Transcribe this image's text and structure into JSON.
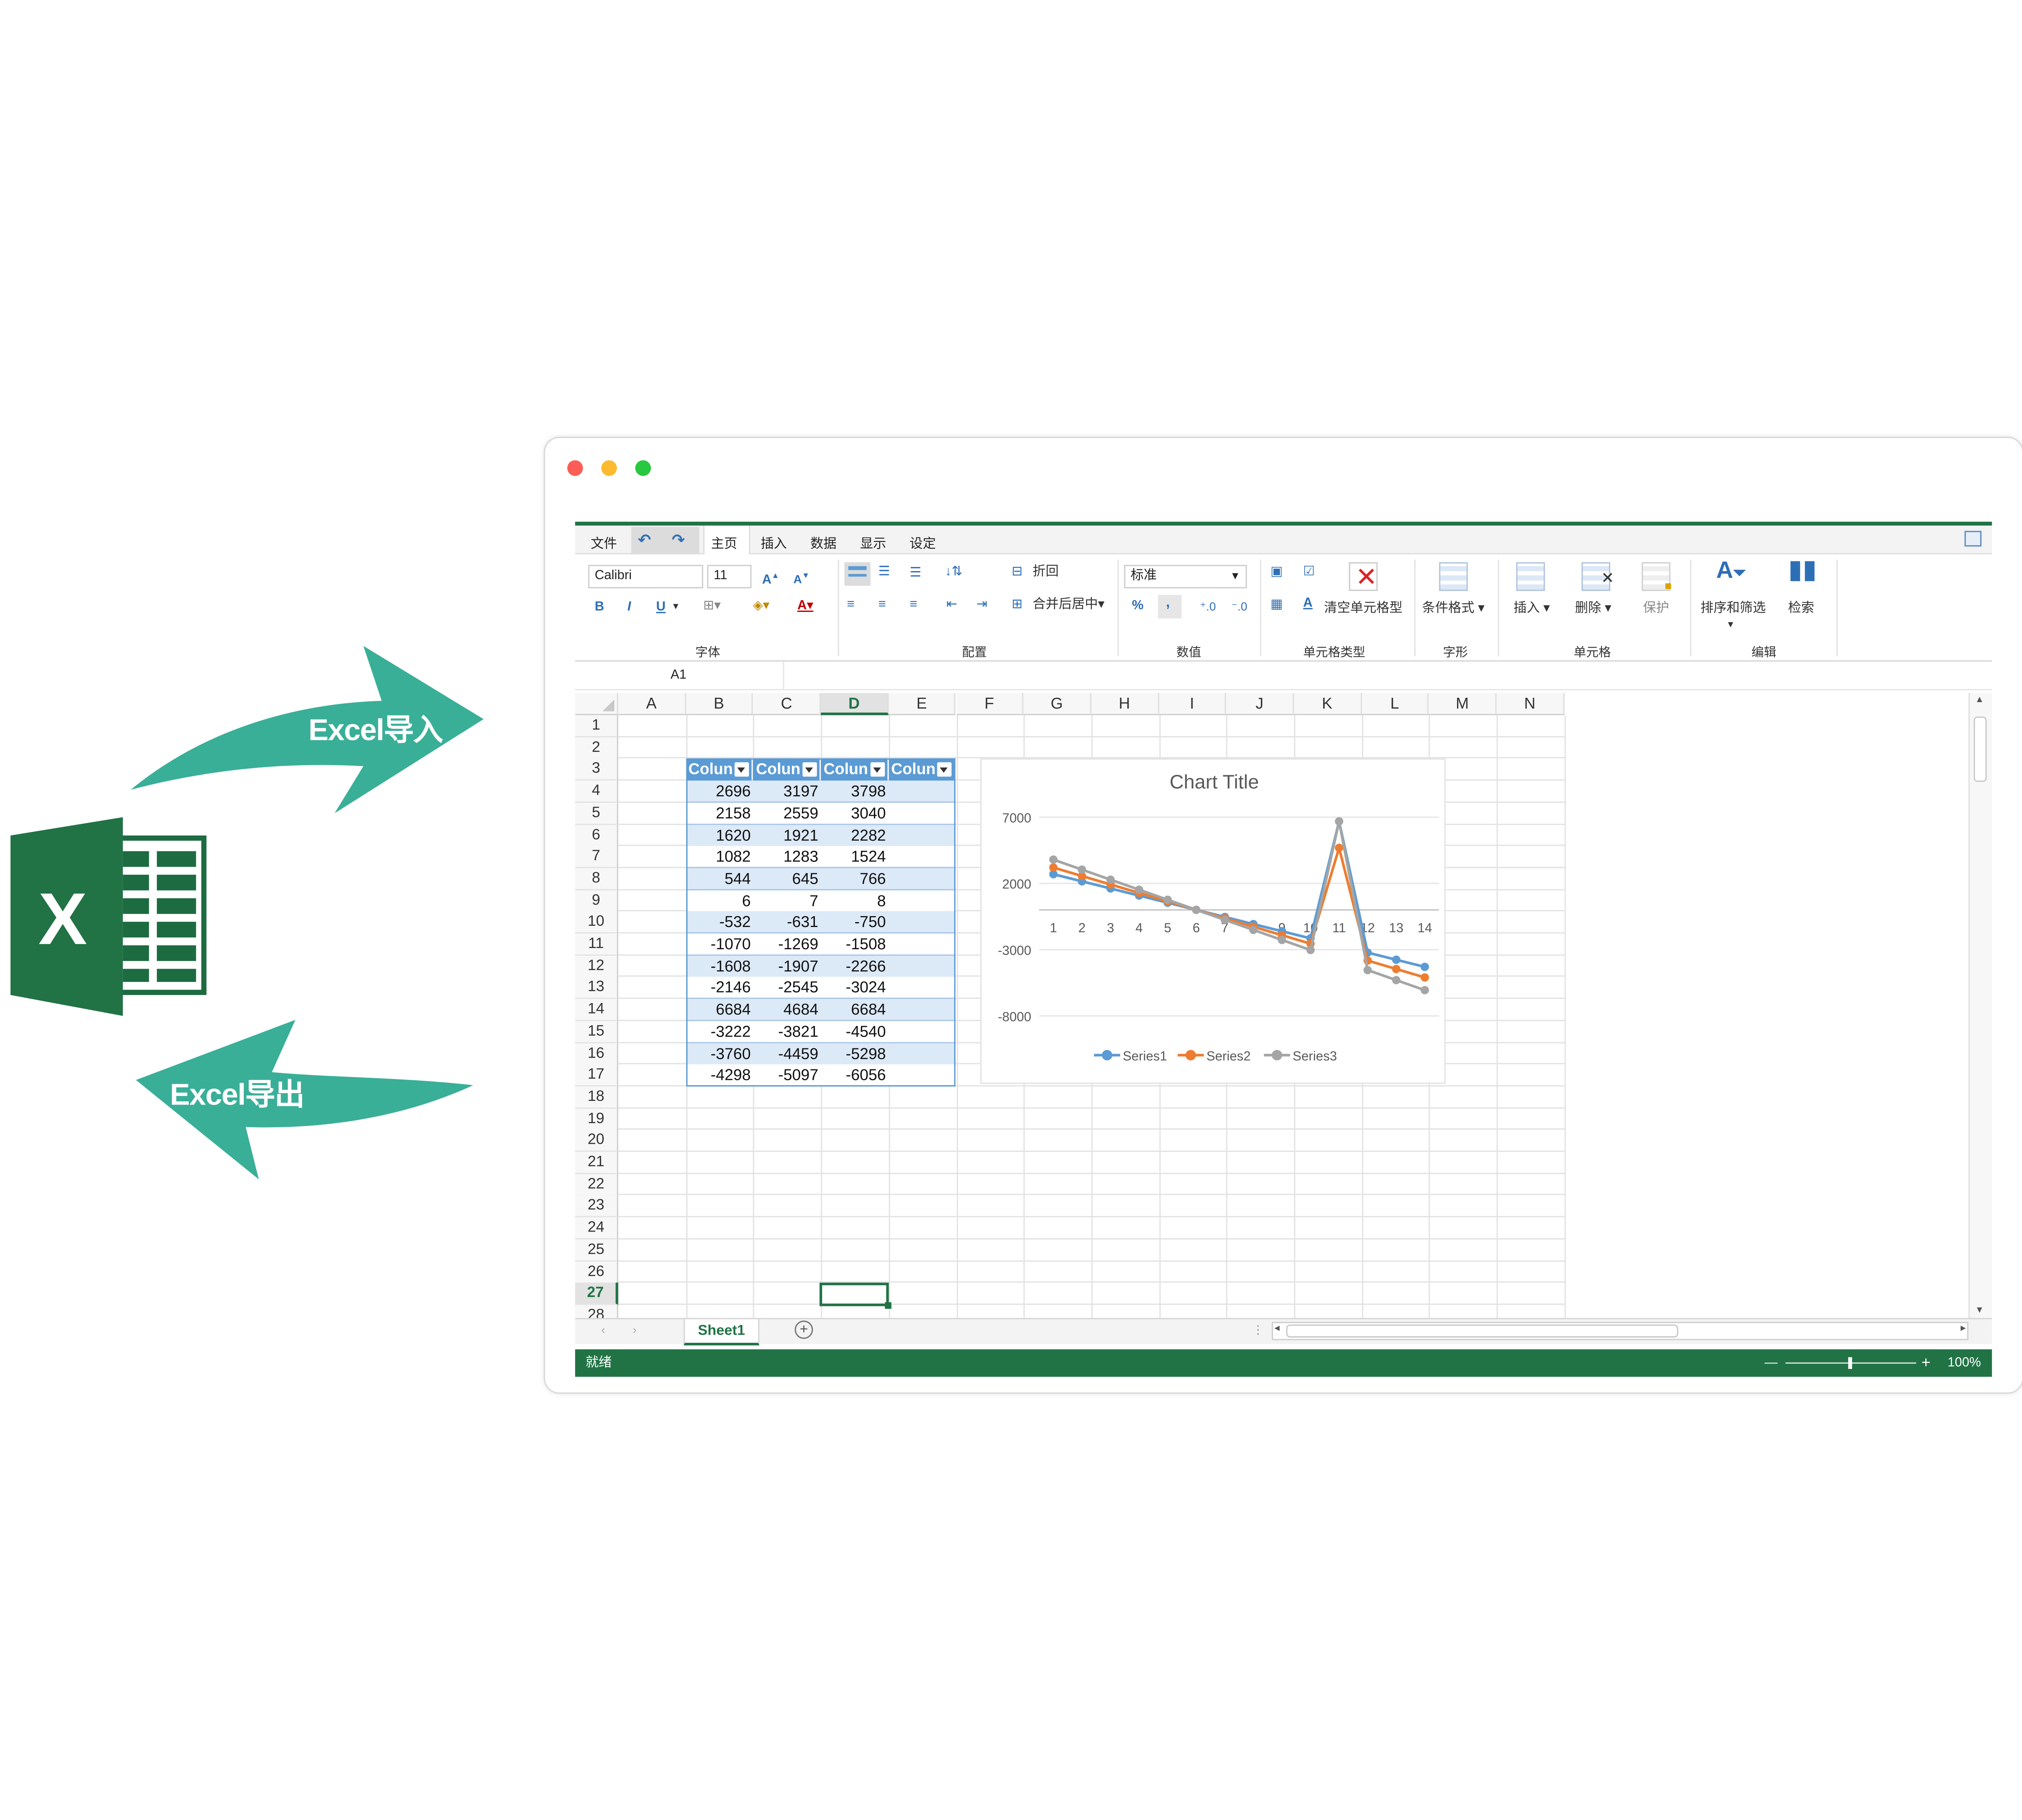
{
  "illustration": {
    "import_label": "Excel导入",
    "export_label": "Excel导出",
    "logo_letter": "X",
    "colors": {
      "arrow": "#3aaf98",
      "excel_dark": "#1d6b41",
      "excel_mid": "#217346"
    }
  },
  "app": {
    "menu": {
      "file": "文件",
      "undo_icon": "undo-icon",
      "redo_icon": "redo-icon",
      "tabs": [
        "主页",
        "插入",
        "数据",
        "显示",
        "设定"
      ]
    },
    "ribbon": {
      "font_name": "Calibri",
      "font_size": "11",
      "bold": "B",
      "italic": "I",
      "underline": "U",
      "font_color_letter": "A",
      "wrap_label": "折回",
      "merge_label": "合并后居中",
      "number_format": "标准",
      "percent": "%",
      "comma": ",",
      "clear_format_label": "清空单元格型",
      "conditional_label": "条件格式",
      "insert_label": "插入",
      "delete_label": "删除",
      "protect_label": "保护",
      "sort_filter_label": "排序和筛选",
      "search_label": "检索",
      "groups": [
        "字体",
        "配置",
        "数值",
        "单元格类型",
        "字形",
        "单元格",
        "编辑"
      ]
    },
    "name_box": "A1",
    "columns": [
      "A",
      "B",
      "C",
      "D",
      "E",
      "F",
      "G",
      "H",
      "I",
      "J",
      "K",
      "L",
      "M",
      "N"
    ],
    "active_column": "D",
    "rows": [
      "1",
      "2",
      "3",
      "4",
      "5",
      "6",
      "7",
      "8",
      "9",
      "10",
      "11",
      "12",
      "13",
      "14",
      "15",
      "16",
      "17",
      "18",
      "19",
      "20",
      "21",
      "22",
      "23",
      "24",
      "25",
      "26",
      "27",
      "28"
    ],
    "active_row": "27",
    "table": {
      "headers": [
        "Colun",
        "Colun",
        "Colun",
        "Colun"
      ],
      "rows": [
        [
          "2696",
          "3197",
          "3798"
        ],
        [
          "2158",
          "2559",
          "3040"
        ],
        [
          "1620",
          "1921",
          "2282"
        ],
        [
          "1082",
          "1283",
          "1524"
        ],
        [
          "544",
          "645",
          "766"
        ],
        [
          "6",
          "7",
          "8"
        ],
        [
          "-532",
          "-631",
          "-750"
        ],
        [
          "-1070",
          "-1269",
          "-1508"
        ],
        [
          "-1608",
          "-1907",
          "-2266"
        ],
        [
          "-2146",
          "-2545",
          "-3024"
        ],
        [
          "6684",
          "4684",
          "6684"
        ],
        [
          "-3222",
          "-3821",
          "-4540"
        ],
        [
          "-3760",
          "-4459",
          "-5298"
        ],
        [
          "-4298",
          "-5097",
          "-6056"
        ]
      ]
    },
    "sheet_tab": "Sheet1",
    "status": "就绪",
    "zoom": "100%"
  },
  "chart_data": {
    "type": "line",
    "title": "Chart Title",
    "x": [
      1,
      2,
      3,
      4,
      5,
      6,
      7,
      8,
      9,
      10,
      11,
      12,
      13,
      14
    ],
    "ylim": [
      -8000,
      7000
    ],
    "yticks": [
      7000,
      2000,
      -3000,
      -8000
    ],
    "series": [
      {
        "name": "Series1",
        "color": "#5b9bd5",
        "values": [
          2696,
          2158,
          1620,
          1082,
          544,
          6,
          -532,
          -1070,
          -1608,
          -2146,
          6684,
          -3222,
          -3760,
          -4298
        ]
      },
      {
        "name": "Series2",
        "color": "#ed7d31",
        "values": [
          3197,
          2559,
          1921,
          1283,
          645,
          7,
          -631,
          -1269,
          -1907,
          -2545,
          4684,
          -3821,
          -4459,
          -5097
        ]
      },
      {
        "name": "Series3",
        "color": "#a5a5a5",
        "values": [
          3798,
          3040,
          2282,
          1524,
          766,
          8,
          -750,
          -1508,
          -2266,
          -3024,
          6684,
          -4540,
          -5298,
          -6056
        ]
      }
    ],
    "legend": "bottom",
    "grid": true
  }
}
